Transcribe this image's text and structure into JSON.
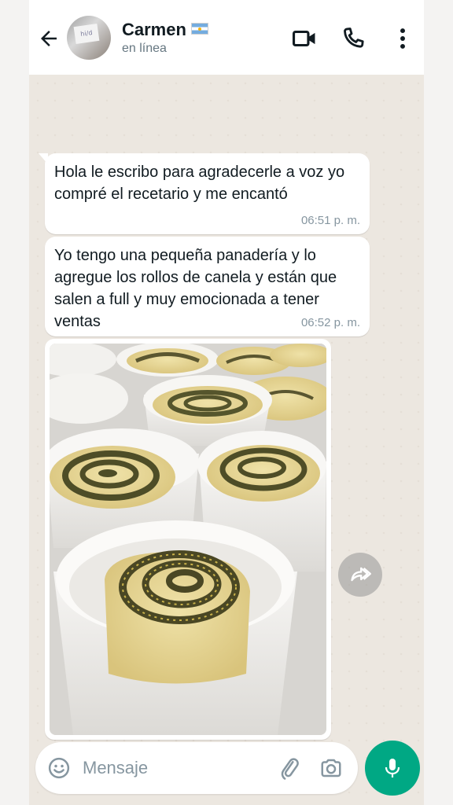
{
  "header": {
    "contact_name": "Carmen",
    "status": "en línea",
    "avatar_text": "hi/d"
  },
  "messages": [
    {
      "text": "Hola le escribo para agradecerle a voz yo compré el recetario y me encantó",
      "time": "06:51 p. m."
    },
    {
      "text": "Yo tengo una pequeña panadería y lo agregue los rollos de canela y están que salen a full y muy emocionada a tener ventas",
      "time": "06:52 p. m."
    }
  ],
  "composer": {
    "placeholder": "Mensaje"
  },
  "colors": {
    "accent": "#00a884",
    "chat_background": "#ece7e0",
    "bubble": "#ffffff",
    "timestamp": "#8696a0"
  },
  "icons": [
    "back-arrow-icon",
    "argentina-flag-icon",
    "video-call-icon",
    "phone-icon",
    "more-vert-icon",
    "forward-icon",
    "emoji-icon",
    "attach-icon",
    "camera-icon",
    "mic-icon"
  ]
}
